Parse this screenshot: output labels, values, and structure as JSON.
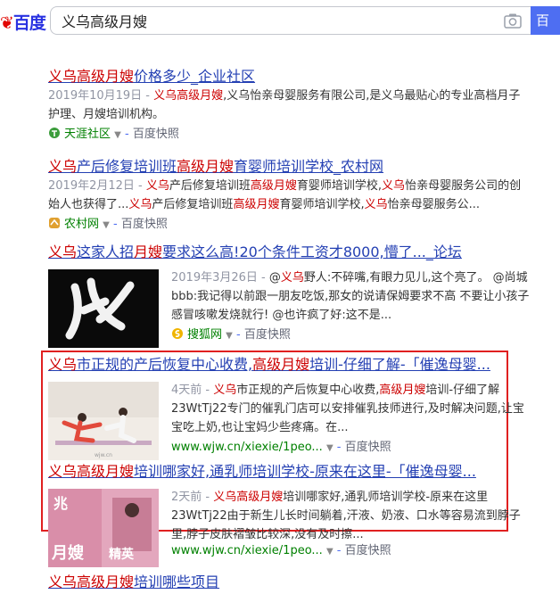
{
  "header": {
    "logo": "百度",
    "query": "义乌高级月嫂",
    "search_button": "百"
  },
  "results": [
    {
      "title": [
        "义乌高级月嫂",
        "价格多少_企业社区"
      ],
      "abs_date": "2019年10月19日 - ",
      "abs": [
        [
          "义乌高级月嫂",
          true
        ],
        [
          ",义乌怡亲母婴服务有限公司,是义乌最贴心的专业高档月子护理、月嫂培训机构。",
          false
        ]
      ],
      "source": "天涯社区",
      "snapshot": "百度快照"
    },
    {
      "title": [
        "义乌",
        "产后修复培训班",
        "高级月嫂",
        "育婴师培训学校_农村网"
      ],
      "abs_date": "2019年2月12日 - ",
      "abs": [
        [
          "义乌",
          true
        ],
        [
          "产后修复培训班",
          false
        ],
        [
          "高级月嫂",
          true
        ],
        [
          "育婴师培训学校,",
          false
        ],
        [
          "义乌",
          true
        ],
        [
          "怡亲母婴服务公司的创始人也获得了...",
          false
        ],
        [
          "义乌",
          true
        ],
        [
          "产后修复培训班",
          false
        ],
        [
          "高级月嫂",
          true
        ],
        [
          "育婴师培训学校,",
          false
        ],
        [
          "义乌",
          true
        ],
        [
          "怡亲母婴服务公...",
          false
        ]
      ],
      "source": "农村网",
      "snapshot": "百度快照"
    },
    {
      "title": [
        "义乌",
        "这家人招",
        "月嫂",
        "要求这么高!20个条件工资才8000,懵了..._论坛"
      ],
      "abs_date": "2019年3月26日 - ",
      "abs": [
        [
          "@",
          false
        ],
        [
          "义乌",
          true
        ],
        [
          "野人:不碎嘴,有眼力见儿,这个亮了。 @尚城bbb:我记得以前跟一朋友吃饭,那女的说请保姆要求不高 不要让小孩子感冒咳嗽发烧就行! @也许疯了好:这不是...",
          false
        ]
      ],
      "source": "搜狐网",
      "snapshot": "百度快照"
    },
    {
      "title": [
        "义乌",
        "市正规的产后恢复中心收费,",
        "高级月嫂",
        "培训-仔细了解-「催逸母婴..."
      ],
      "abs_date": "4天前 - ",
      "abs": [
        [
          "义乌",
          true
        ],
        [
          "市正规的产后恢复中心收费,",
          false
        ],
        [
          "高级月嫂",
          true
        ],
        [
          "培训-仔细了解23WtTj22专门的催乳门店可以安排催乳技师进行,及时解决问题,让宝宝吃上奶,也让宝妈少些疼痛。在...",
          false
        ]
      ],
      "source": "www.wjw.cn/xiexie/1peo...",
      "snapshot": "百度快照"
    },
    {
      "title": [
        "义乌高级月嫂",
        "培训哪家好,通乳师培训学校-原来在这里-「催逸母婴..."
      ],
      "abs_date": "2天前 - ",
      "abs": [
        [
          "义乌高级月嫂",
          true
        ],
        [
          "培训哪家好,通乳师培训学校-原来在这里23WtTj22由于新生儿长时间躺着,汗液、奶液、口水等容易流到脖子里,脖子皮肤褶皱比较深,没有及时擦...",
          false
        ]
      ],
      "source": "www.wjw.cn/xiexie/1peo...",
      "snapshot": "百度快照"
    },
    {
      "title": [
        "义乌高级月嫂",
        "培训哪些项目"
      ]
    }
  ],
  "thumb_captions": [
    "兆",
    "月嫂",
    "精英"
  ],
  "colors": {
    "link": "#2440b3",
    "highlight": "#cc0000",
    "redbox": "#e02020",
    "green": "#008000"
  }
}
